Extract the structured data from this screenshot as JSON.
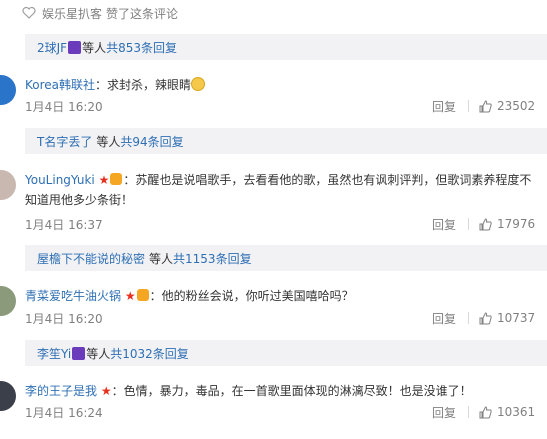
{
  "top": {
    "user": "娱乐星扒客",
    "action": "赞了这条评论"
  },
  "blocks": [
    {
      "name": "2球JF",
      "suffix": "等人",
      "count_text": "共853条回复"
    },
    {
      "name": "T名字丢了",
      "suffix": "等人",
      "count_text": "共94条回复"
    },
    {
      "name": "屋檐下不能说的秘密",
      "suffix": "等人",
      "count_text": "共1153条回复"
    },
    {
      "name": "李笙Yi",
      "suffix": "等人",
      "count_text": "共1032条回复"
    }
  ],
  "comments": [
    {
      "user": "Korea韩联社",
      "text": "：求封杀，辣眼睛",
      "time": "1月4日 16:20",
      "reply": "回复",
      "likes": "23502"
    },
    {
      "user": "YouLingYuki",
      "text": "：苏醒也是说唱歌手，去看看他的歌，虽然也有讽刺评判，但歌词素养程度不知道甩他多少条街！",
      "time": "1月4日 16:37",
      "reply": "回复",
      "likes": "17976"
    },
    {
      "user": "青菜爱吃牛油火锅",
      "text": "：他的粉丝会说，你听过美国嘻哈吗？",
      "time": "1月4日 16:20",
      "reply": "回复",
      "likes": "10737"
    },
    {
      "user": "李的王子是我",
      "text": "：色情，暴力，毒品，在一首歌里面体现的淋漓尽致！也是没谁了！",
      "time": "1月4日 16:24",
      "reply": "回复",
      "likes": "10361"
    }
  ],
  "colors": {
    "accent": "#eb7350",
    "link": "#2e6fb4",
    "muted": "#808080",
    "panel": "#f2f2f5"
  },
  "icons": {
    "top": "heart-icon",
    "like": "thumbs-up-icon",
    "badge": "weibo-member-badge"
  }
}
